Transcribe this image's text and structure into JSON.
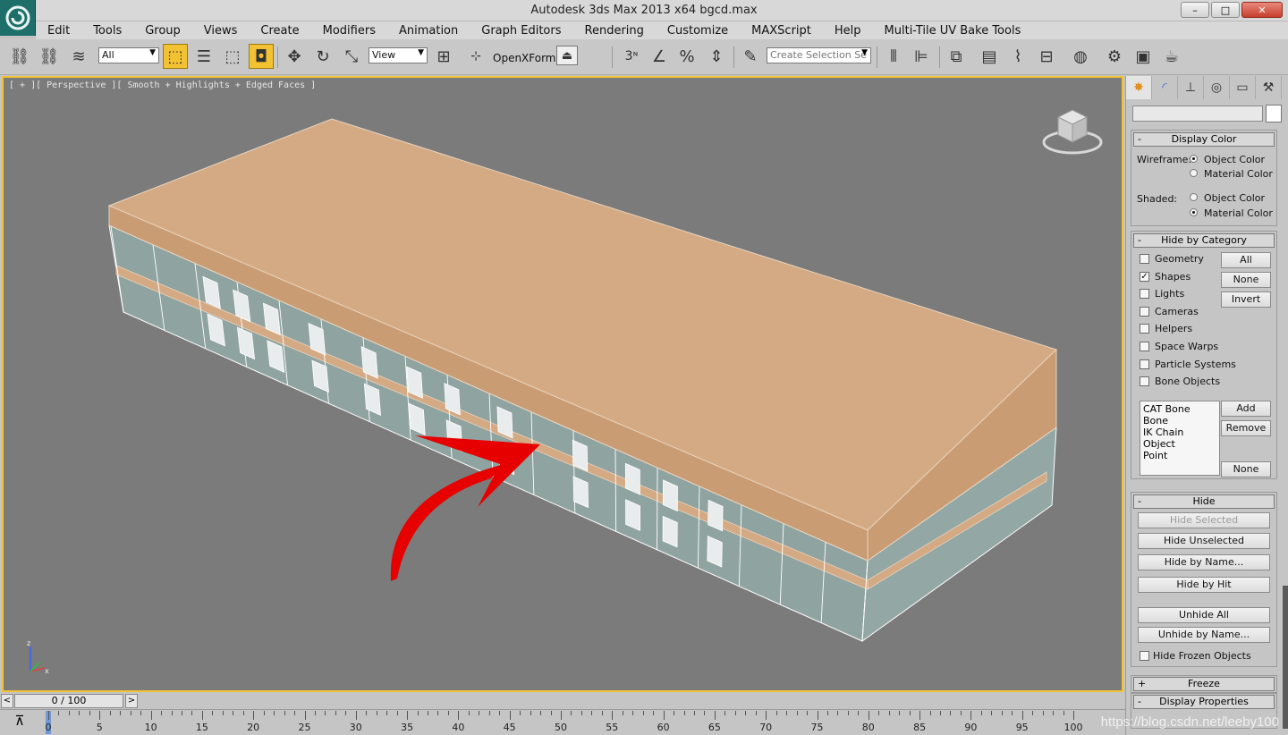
{
  "window": {
    "title": "Autodesk 3ds Max  2013 x64      bgcd.max"
  },
  "menu": [
    "Edit",
    "Tools",
    "Group",
    "Views",
    "Create",
    "Modifiers",
    "Animation",
    "Graph Editors",
    "Rendering",
    "Customize",
    "MAXScript",
    "Help",
    "Multi-Tile UV Bake Tools"
  ],
  "toolbar": {
    "selection_filter": "All",
    "ref_coord": "View",
    "openxformer_label": "OpenXFormer",
    "named_selection_placeholder": "Create Selection Se",
    "icons": [
      "link-icon",
      "unlink-icon",
      "bind-spacewarp-icon",
      "select-object-icon",
      "select-by-name-icon",
      "rect-selection-icon",
      "window-crossing-icon",
      "move-icon",
      "rotate-icon",
      "scale-icon",
      "pivot-icon",
      "snap-3-icon",
      "angle-snap-icon",
      "percent-snap-icon",
      "spinner-snap-icon",
      "edit-named-selections-icon",
      "mirror-icon",
      "align-icon",
      "layer-manager-icon",
      "graphite-icon",
      "curve-editor-icon",
      "schematic-icon",
      "material-editor-icon",
      "render-setup-icon",
      "rendered-frame-icon",
      "render-icon"
    ]
  },
  "viewport": {
    "label": "[ + ][ Perspective ][ Smooth + Highlights + Edged Faces ]"
  },
  "command_panel": {
    "tabs": [
      "create-tab-icon",
      "modify-tab-icon",
      "hierarchy-tab-icon",
      "motion-tab-icon",
      "display-tab-icon",
      "utilities-tab-icon"
    ],
    "display_color": {
      "title": "Display Color",
      "wireframe_label": "Wireframe:",
      "shaded_label": "Shaded:",
      "object_color": "Object Color",
      "material_color": "Material Color"
    },
    "hide_by_category": {
      "title": "Hide by Category",
      "items": [
        "Geometry",
        "Shapes",
        "Lights",
        "Cameras",
        "Helpers",
        "Space Warps",
        "Particle Systems",
        "Bone Objects"
      ],
      "checked": [
        false,
        true,
        false,
        false,
        false,
        false,
        false,
        false
      ],
      "all": "All",
      "none": "None",
      "invert": "Invert",
      "list": [
        "CAT Bone",
        "Bone",
        "IK Chain Object",
        "Point"
      ],
      "add": "Add",
      "remove": "Remove",
      "none2": "None"
    },
    "hide": {
      "title": "Hide",
      "hide_selected": "Hide Selected",
      "hide_unselected": "Hide Unselected",
      "hide_by_name": "Hide by Name...",
      "hide_by_hit": "Hide by Hit",
      "unhide_all": "Unhide All",
      "unhide_by_name": "Unhide by Name...",
      "hide_frozen": "Hide Frozen Objects"
    },
    "freeze": {
      "title": "Freeze",
      "sign": "+"
    },
    "display_properties": {
      "title": "Display Properties"
    },
    "minus_sign": "-"
  },
  "timeline": {
    "slider_label": "0 / 100",
    "prev": "<",
    "next": ">",
    "ticks": [
      "0",
      "5",
      "10",
      "15",
      "20",
      "25",
      "30",
      "35",
      "40",
      "45",
      "50",
      "55",
      "60",
      "65",
      "70",
      "75",
      "80",
      "85",
      "90",
      "95",
      "100"
    ]
  },
  "watermark": "https://blog.csdn.net/leeby100",
  "colors": {
    "viewport_bg": "#7b7b7b",
    "active_border": "#f2c232",
    "roof": "#d4aa84",
    "wall": "#8fa3a1",
    "annotation_arrow": "#e60000"
  }
}
